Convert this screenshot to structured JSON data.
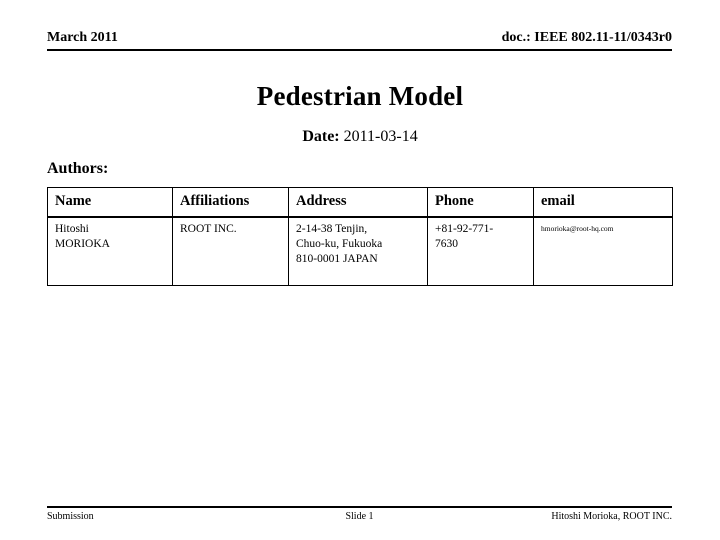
{
  "header": {
    "left": "March 2011",
    "right": "doc.: IEEE 802.11-11/0343r0"
  },
  "title": "Pedestrian Model",
  "subtitle": {
    "label": "Date:",
    "value": "2011-03-14"
  },
  "authors": {
    "label": "Authors:",
    "columns": [
      "Name",
      "Affiliations",
      "Address",
      "Phone",
      "email"
    ],
    "rows": [
      {
        "name": [
          "Hitoshi",
          "MORIOKA"
        ],
        "affiliation": [
          "ROOT INC."
        ],
        "address": [
          "2-14-38 Tenjin,",
          "Chuo-ku, Fukuoka",
          "810-0001 JAPAN"
        ],
        "phone": [
          "+81-92-771-",
          "7630"
        ],
        "email": [
          "hmorioka@root-hq.com"
        ]
      }
    ]
  },
  "footer": {
    "left": "Submission",
    "center": "Slide 1",
    "right": "Hitoshi Morioka, ROOT INC."
  }
}
